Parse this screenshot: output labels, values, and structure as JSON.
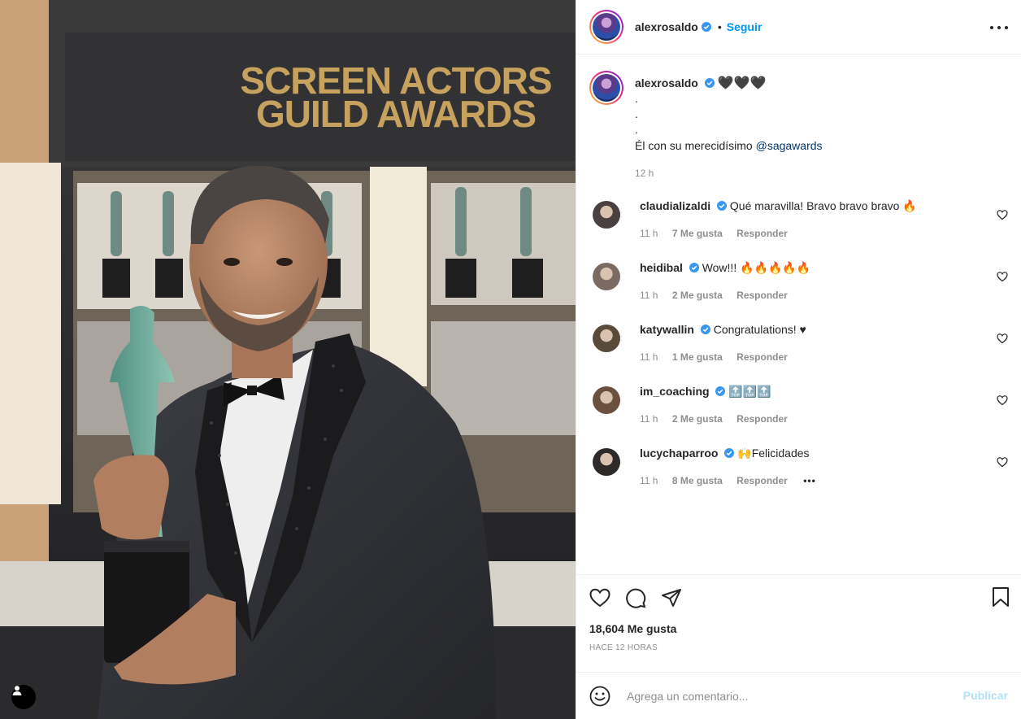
{
  "photo": {
    "signage_line1": "SCREEN ACTORS",
    "signage_line2": "GUILD AWARDS"
  },
  "header": {
    "username": "alexrosaldo",
    "separator": "•",
    "follow_label": "Seguir",
    "more_icon": "more-horizontal-icon"
  },
  "caption": {
    "username": "alexrosaldo",
    "hearts": "🖤🖤🖤",
    "dot_lines": [
      ".",
      ".",
      "."
    ],
    "text_prefix": "Él con su merecidísimo ",
    "mention": "@sagawards",
    "time": "12 h"
  },
  "comments": [
    {
      "username": "claudializaldi",
      "text": "Qué maravilla! Bravo bravo bravo 🔥",
      "time": "11 h",
      "likes": "7 Me gusta",
      "reply": "Responder",
      "avatar_color": "#4a4040"
    },
    {
      "username": "heidibal",
      "text": "Wow!!! 🔥🔥🔥🔥🔥",
      "time": "11 h",
      "likes": "2 Me gusta",
      "reply": "Responder",
      "avatar_color": "#7a6a62"
    },
    {
      "username": "katywallin",
      "text": "Congratulations! ♥",
      "time": "11 h",
      "likes": "1 Me gusta",
      "reply": "Responder",
      "avatar_color": "#5a4a3a"
    },
    {
      "username": "im_coaching",
      "text": "🔝🔝🔝",
      "time": "11 h",
      "likes": "2 Me gusta",
      "reply": "Responder",
      "avatar_color": "#6b5040"
    },
    {
      "username": "lucychaparroo",
      "text": "🙌Felicidades",
      "time": "11 h",
      "likes": "8 Me gusta",
      "reply": "Responder",
      "more": "•••",
      "avatar_color": "#2e2a2a"
    }
  ],
  "actions": {
    "icons": [
      "heart-icon",
      "comment-icon",
      "share-icon",
      "bookmark-icon"
    ],
    "likes_count": "18,604 Me gusta",
    "posted_ago": "HACE 12 HORAS"
  },
  "add_comment": {
    "placeholder": "Agrega un comentario...",
    "post_label": "Publicar"
  },
  "colors": {
    "link": "#0095f6",
    "verified": "#3897f0",
    "muted": "#8e8e8e",
    "border": "#efefef"
  }
}
